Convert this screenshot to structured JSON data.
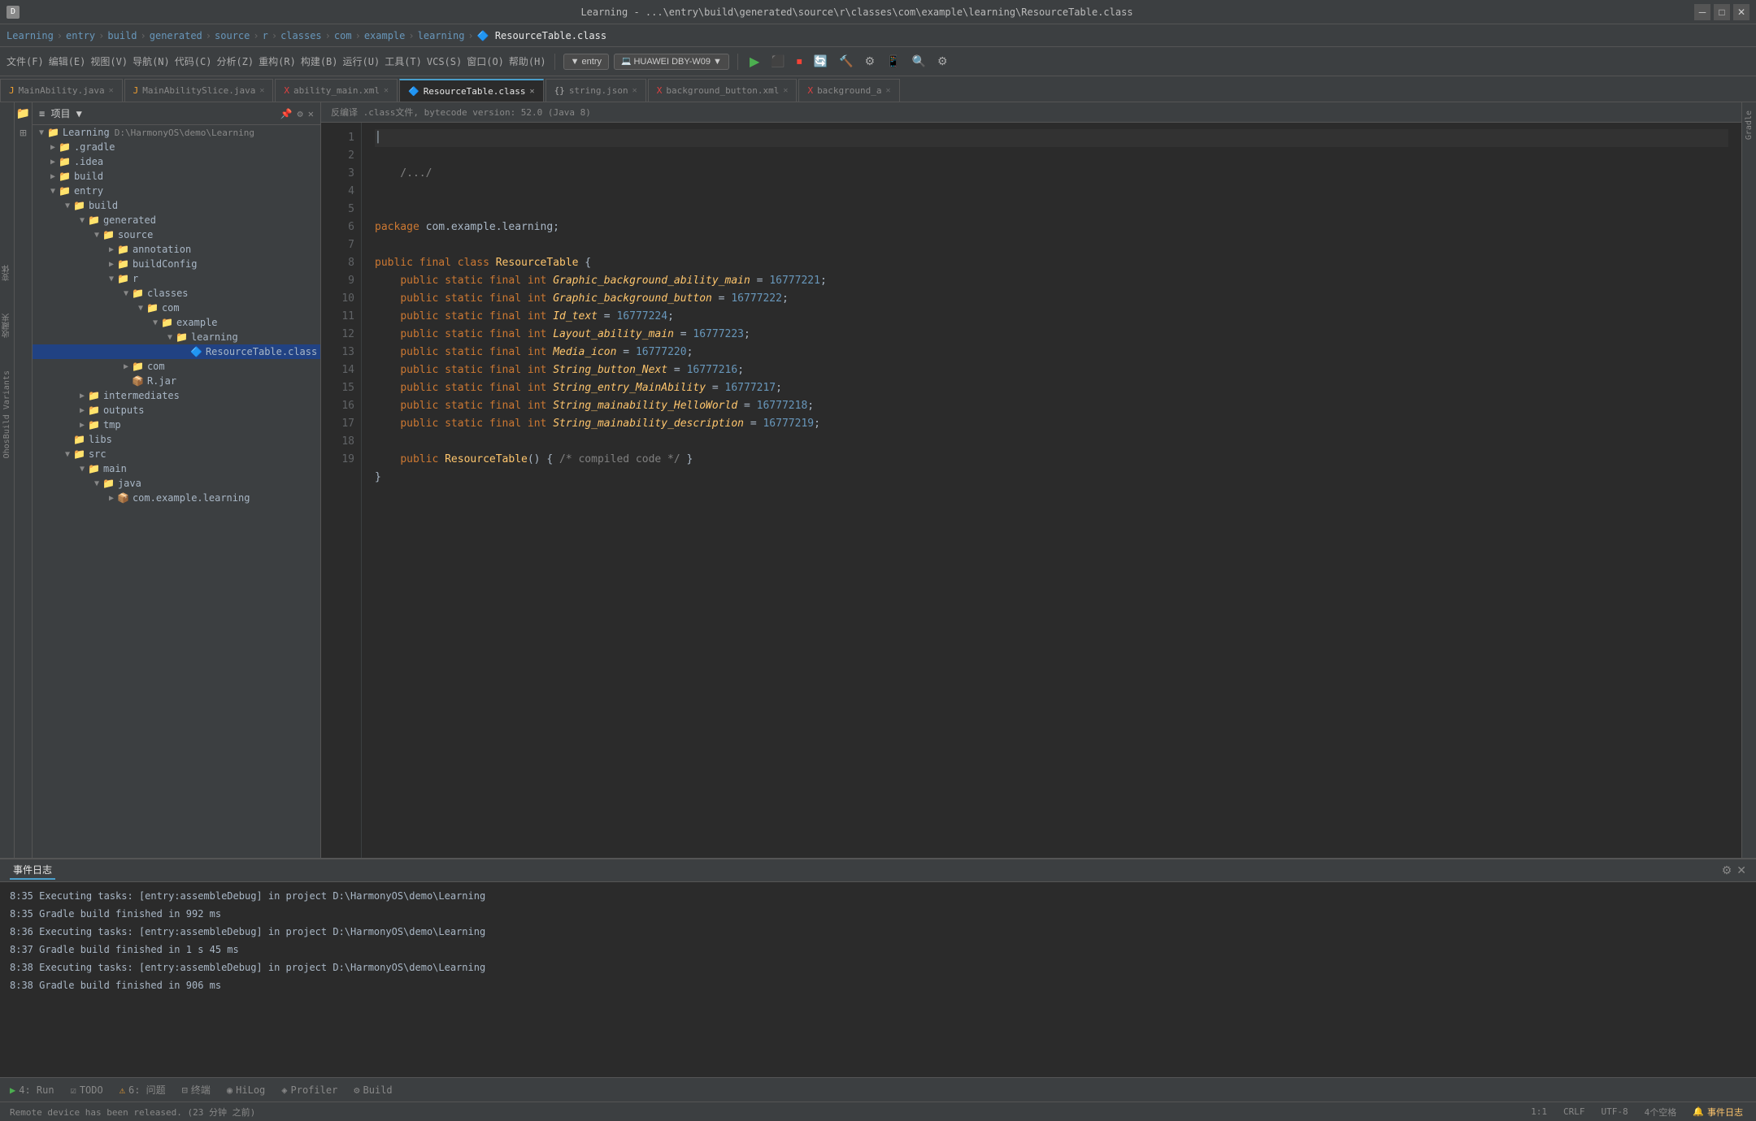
{
  "titleBar": {
    "title": "Learning - ...\\entry\\build\\generated\\source\\r\\classes\\com\\example\\learning\\ResourceTable.class",
    "controls": [
      "minimize",
      "maximize",
      "close"
    ]
  },
  "breadcrumb": {
    "items": [
      "Learning",
      "entry",
      "build",
      "generated",
      "source",
      "r",
      "classes",
      "com",
      "example",
      "learning",
      "ResourceTable.class"
    ]
  },
  "toolbar": {
    "entryLabel": "▼ entry",
    "deviceLabel": "HUAWEI DBY-W09 ▼"
  },
  "tabs": [
    {
      "id": "tab1",
      "label": "MainAbility.java",
      "icon": "J",
      "active": false,
      "modified": false
    },
    {
      "id": "tab2",
      "label": "MainAbilitySlice.java",
      "icon": "J",
      "active": false,
      "modified": false
    },
    {
      "id": "tab3",
      "label": "ability_main.xml",
      "icon": "X",
      "active": false,
      "modified": false
    },
    {
      "id": "tab4",
      "label": "ResourceTable.class",
      "icon": "C",
      "active": true,
      "modified": false
    },
    {
      "id": "tab5",
      "label": "string.json",
      "icon": "{}",
      "active": false,
      "modified": false
    },
    {
      "id": "tab6",
      "label": "background_button.xml",
      "icon": "X",
      "active": false,
      "modified": false
    },
    {
      "id": "tab7",
      "label": "background_a",
      "icon": "X",
      "active": false,
      "modified": false
    }
  ],
  "fileTree": {
    "rootLabel": "项目",
    "rootPath": "D:\\HarmonyOS\\demo\\Learning",
    "items": [
      {
        "id": "learning-root",
        "label": "Learning",
        "path": "D:\\HarmonyOS\\demo\\Learning",
        "type": "root",
        "indent": 0,
        "expanded": true
      },
      {
        "id": "gradle",
        "label": ".gradle",
        "type": "folder",
        "indent": 1,
        "expanded": false
      },
      {
        "id": "idea",
        "label": ".idea",
        "type": "folder",
        "indent": 1,
        "expanded": false
      },
      {
        "id": "build-top",
        "label": "build",
        "type": "folder",
        "indent": 1,
        "expanded": false
      },
      {
        "id": "entry",
        "label": "entry",
        "type": "folder",
        "indent": 1,
        "expanded": true
      },
      {
        "id": "build",
        "label": "build",
        "type": "folder",
        "indent": 2,
        "expanded": true
      },
      {
        "id": "generated",
        "label": "generated",
        "type": "folder",
        "indent": 3,
        "expanded": true
      },
      {
        "id": "source",
        "label": "source",
        "type": "folder",
        "indent": 4,
        "expanded": true
      },
      {
        "id": "annotation",
        "label": "annotation",
        "type": "folder",
        "indent": 5,
        "expanded": false
      },
      {
        "id": "buildConfig",
        "label": "buildConfig",
        "type": "folder",
        "indent": 5,
        "expanded": false
      },
      {
        "id": "r",
        "label": "r",
        "type": "folder",
        "indent": 5,
        "expanded": true
      },
      {
        "id": "classes",
        "label": "classes",
        "type": "folder",
        "indent": 6,
        "expanded": true
      },
      {
        "id": "com",
        "label": "com",
        "type": "folder",
        "indent": 7,
        "expanded": true
      },
      {
        "id": "example",
        "label": "example",
        "type": "folder",
        "indent": 8,
        "expanded": true
      },
      {
        "id": "learning-pkg",
        "label": "learning",
        "type": "folder",
        "indent": 9,
        "expanded": true
      },
      {
        "id": "resource-table",
        "label": "ResourceTable.class",
        "type": "class-file",
        "indent": 10,
        "expanded": false,
        "selected": true
      },
      {
        "id": "com2",
        "label": "com",
        "type": "folder",
        "indent": 6,
        "expanded": false
      },
      {
        "id": "rjar",
        "label": "R.jar",
        "type": "jar",
        "indent": 6,
        "expanded": false
      },
      {
        "id": "intermediates",
        "label": "intermediates",
        "type": "folder",
        "indent": 3,
        "expanded": false
      },
      {
        "id": "outputs",
        "label": "outputs",
        "type": "folder",
        "indent": 3,
        "expanded": false
      },
      {
        "id": "tmp",
        "label": "tmp",
        "type": "folder",
        "indent": 3,
        "expanded": false
      },
      {
        "id": "libs",
        "label": "libs",
        "type": "folder",
        "indent": 2,
        "expanded": false
      },
      {
        "id": "src",
        "label": "src",
        "type": "folder",
        "indent": 2,
        "expanded": true
      },
      {
        "id": "main",
        "label": "main",
        "type": "folder",
        "indent": 3,
        "expanded": true
      },
      {
        "id": "java",
        "label": "java",
        "type": "folder",
        "indent": 4,
        "expanded": true
      },
      {
        "id": "com-example-learning",
        "label": "com.example.learning",
        "type": "package",
        "indent": 5,
        "expanded": false
      }
    ]
  },
  "editor": {
    "decompileNotice": "反编译 .class文件, bytecode version: 52.0 (Java 8)",
    "lines": [
      {
        "n": 1,
        "code": ""
      },
      {
        "n": 2,
        "code": "    /.../"
      },
      {
        "n": 3,
        "code": ""
      },
      {
        "n": 4,
        "code": ""
      },
      {
        "n": 5,
        "code": "package com.example.learning;"
      },
      {
        "n": 6,
        "code": ""
      },
      {
        "n": 7,
        "code": "public final class ResourceTable {"
      },
      {
        "n": 8,
        "code": "    public static final int Graphic_background_ability_main = 16777221;"
      },
      {
        "n": 9,
        "code": "    public static final int Graphic_background_button = 16777222;"
      },
      {
        "n": 10,
        "code": "    public static final int Id_text = 16777224;"
      },
      {
        "n": 11,
        "code": "    public static final int Layout_ability_main = 16777223;"
      },
      {
        "n": 12,
        "code": "    public static final int Media_icon = 16777220;"
      },
      {
        "n": 13,
        "code": "    public static final int String_button_Next = 16777216;"
      },
      {
        "n": 14,
        "code": "    public static final int String_entry_MainAbility = 16777217;"
      },
      {
        "n": 15,
        "code": "    public static final int String_mainability_HelloWorld = 16777218;"
      },
      {
        "n": 16,
        "code": "    public static final int String_mainability_description = 16777219;"
      },
      {
        "n": 17,
        "code": ""
      },
      {
        "n": 18,
        "code": "    public ResourceTable() { /* compiled code */ }"
      },
      {
        "n": 19,
        "code": "}"
      }
    ]
  },
  "bottomPanel": {
    "title": "事件日志",
    "logs": [
      {
        "time": "8:35",
        "message": "Executing tasks: [entry:assembleDebug] in project D:\\HarmonyOS\\demo\\Learning"
      },
      {
        "time": "8:35",
        "message": "Gradle build finished in 992 ms"
      },
      {
        "time": "8:36",
        "message": "Executing tasks: [entry:assembleDebug] in project D:\\HarmonyOS\\demo\\Learning"
      },
      {
        "time": "8:37",
        "message": "Gradle build finished in 1 s 45 ms"
      },
      {
        "time": "8:38",
        "message": "Executing tasks: [entry:assembleDebug] in project D:\\HarmonyOS\\demo\\Learning"
      },
      {
        "time": "8:38",
        "message": "Gradle build finished in 906 ms"
      }
    ]
  },
  "bottomActions": [
    {
      "id": "run",
      "icon": "▶",
      "label": "4: Run"
    },
    {
      "id": "todo",
      "icon": "☑",
      "label": "TODO"
    },
    {
      "id": "problems",
      "icon": "⚠",
      "label": "6: 问题"
    },
    {
      "id": "terminal",
      "icon": "⊟",
      "label": "终端"
    },
    {
      "id": "hilog",
      "icon": "◉",
      "label": "HiLog"
    },
    {
      "id": "profiler",
      "icon": "◈",
      "label": "Profiler"
    },
    {
      "id": "build",
      "icon": "⚙",
      "label": "Build"
    }
  ],
  "statusBar": {
    "position": "1:1",
    "lineEnding": "CRLF",
    "encoding": "UTF-8",
    "indent": "4个空格",
    "buildEvent": "事件日志",
    "remoteStatus": "Remote device has been released. (23 分钟 之前)"
  },
  "farLeftLabels": [
    "变体",
    "收藏夹",
    "OhosBuild Variants"
  ],
  "rightSidebarLabel": "Gradle"
}
